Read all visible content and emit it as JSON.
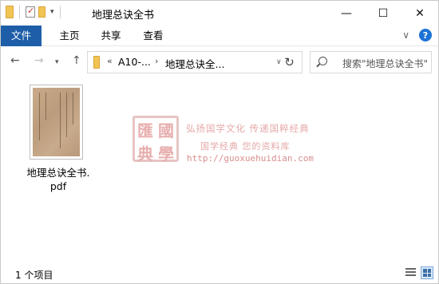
{
  "window": {
    "title": "地理总诀全书",
    "controls": {
      "minimize": "—",
      "maximize": "☐",
      "close": "✕"
    }
  },
  "ribbon": {
    "tabs": [
      {
        "label": "文件",
        "active": true
      },
      {
        "label": "主页"
      },
      {
        "label": "共享"
      },
      {
        "label": "查看"
      }
    ],
    "help": "?"
  },
  "navigation": {
    "breadcrumb_overflow": "«",
    "path": [
      "A10-...",
      "地理总诀全..."
    ],
    "search_placeholder": "搜索\"地理总诀全书\""
  },
  "files": [
    {
      "name_line1": "地理总诀全书.",
      "name_line2": "pdf",
      "icon": "pdf-thumbnail"
    }
  ],
  "watermark": {
    "seal_chars": [
      "國",
      "學",
      "典",
      "匯"
    ],
    "line1": "弘扬国学文化  传递国粹经典",
    "line2": "国学经典 您的资料库",
    "url": "http://guoxuehuidian.com"
  },
  "status": {
    "item_count": "1 个项目"
  },
  "colors": {
    "file_tab_bg": "#1e5ea8",
    "watermark": "#d66d6d"
  }
}
